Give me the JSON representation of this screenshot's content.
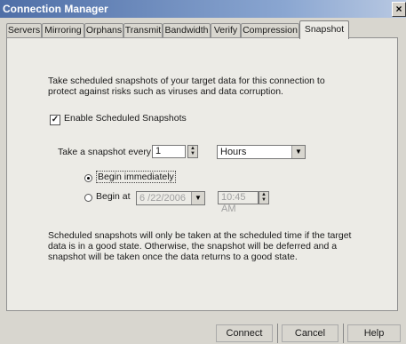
{
  "window": {
    "title": "Connection Manager",
    "close_label": "×"
  },
  "tabs": [
    {
      "label": "Servers"
    },
    {
      "label": "Mirroring"
    },
    {
      "label": "Orphans"
    },
    {
      "label": "Transmit"
    },
    {
      "label": "Bandwidth"
    },
    {
      "label": "Verify"
    },
    {
      "label": "Compression"
    },
    {
      "label": "Snapshot",
      "active": true
    }
  ],
  "snapshot": {
    "description_line1": "Take scheduled snapshots of your target data for this connection to",
    "description_line2": "protect against risks such as viruses and data corruption.",
    "enable_label": "Enable Scheduled Snapshots",
    "enable_checked": true,
    "check_mark": "✓",
    "interval_label": "Take a snapshot every",
    "interval_value": "1",
    "interval_unit": "Hours",
    "begin_immediately_label": "Begin immediately",
    "begin_at_label": "Begin at",
    "selected_begin": "immediately",
    "begin_date": "6 /22/2006",
    "begin_time": "10:45 AM",
    "note_line1": "Scheduled snapshots will only be taken at the scheduled time if the target",
    "note_line2": "data is in a good state. Otherwise, the snapshot will be deferred and a",
    "note_line3": "snapshot will be taken once the data returns to a good state."
  },
  "buttons": {
    "connect": "Connect",
    "cancel": "Cancel",
    "help": "Help"
  },
  "icons": {
    "dropdown": "chevron-down-icon",
    "spin": "spin-arrows-icon"
  }
}
